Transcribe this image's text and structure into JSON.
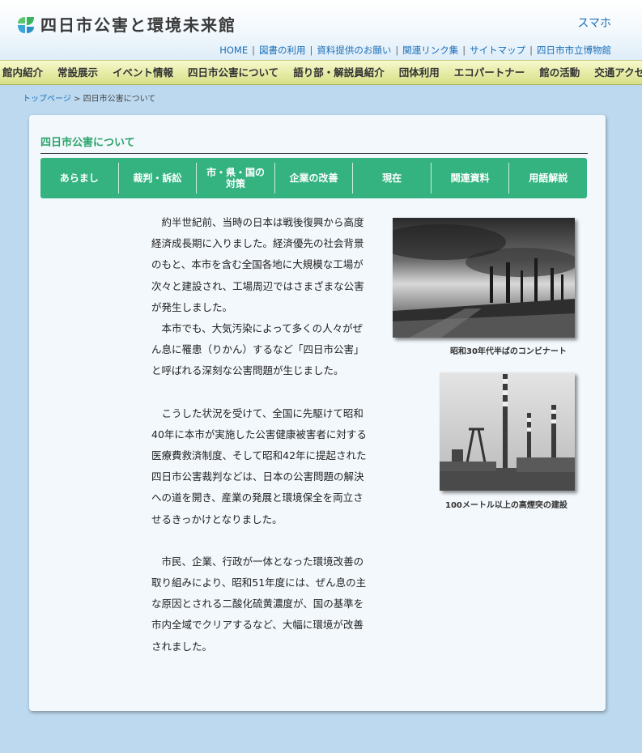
{
  "header": {
    "logo_text": "四日市公害と環境未来館",
    "mobile_link": "スマホ",
    "utility_links": [
      "HOME",
      "図書の利用",
      "資料提供のお願い",
      "関連リンク集",
      "サイトマップ",
      "四日市市立博物館"
    ]
  },
  "global_nav": [
    "館内紹介",
    "常設展示",
    "イベント情報",
    "四日市公害について",
    "語り部・解説員紹介",
    "団体利用",
    "エコパートナー",
    "館の活動",
    "交通アクセス"
  ],
  "breadcrumb": {
    "home": "トップページ",
    "separator": ">",
    "current": "四日市公害について"
  },
  "main": {
    "title": "四日市公害について",
    "tabs": [
      {
        "line1": "あらまし",
        "line2": ""
      },
      {
        "line1": "裁判・訴訟",
        "line2": ""
      },
      {
        "line1": "市・県・国の",
        "line2": "対策"
      },
      {
        "line1": "企業の改善",
        "line2": ""
      },
      {
        "line1": "現在",
        "line2": ""
      },
      {
        "line1": "関連資料",
        "line2": ""
      },
      {
        "line1": "用語解説",
        "line2": ""
      }
    ],
    "paragraphs": [
      "約半世紀前、当時の日本は戦後復興から高度経済成長期に入りました。経済優先の社会背景のもと、本市を含む全国各地に大規模な工場が次々と建設され、工場周辺ではさまざまな公害が発生しました。",
      "本市でも、大気汚染によって多くの人々がぜん息に罹患（りかん）するなど「四日市公害」と呼ばれる深刻な公害問題が生じました。",
      "こうした状況を受けて、全国に先駆けて昭和40年に本市が実施した公害健康被害者に対する医療費救済制度、そして昭和42年に提起された四日市公害裁判などは、日本の公害問題の解決への道を開き、産業の発展と環境保全を両立させるきっかけとなりました。",
      "市民、企業、行政が一体となった環境改善の取り組みにより、昭和51年度には、ぜん息の主な原因とされる二酸化硫黄濃度が、国の基準を市内全域でクリアするなど、大幅に環境が改善されました。"
    ],
    "photos": [
      {
        "caption": "昭和30年代半ばのコンビナート"
      },
      {
        "caption": "100メートル以上の高煙突の建設"
      }
    ]
  },
  "colors": {
    "accent_green": "#34b381",
    "title_green": "#2aa36a",
    "link_blue": "#1a6fb8",
    "nav_bg": "#e8eda9",
    "page_bg": "#bcd9ef"
  }
}
